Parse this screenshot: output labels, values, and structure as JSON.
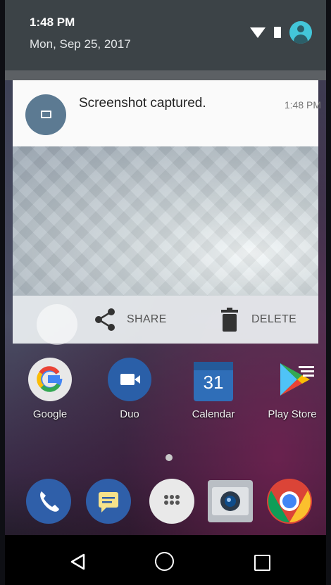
{
  "status": {
    "time": "1:48 PM",
    "date": "Mon, Sep 25, 2017"
  },
  "notification": {
    "title": "Screenshot captured.",
    "time": "1:48 PM",
    "icon": "image-icon"
  },
  "actions": {
    "share_label": "SHARE",
    "delete_label": "DELETE"
  },
  "apps": [
    {
      "label": "Google",
      "icon": "google-icon"
    },
    {
      "label": "Duo",
      "icon": "duo-icon"
    },
    {
      "label": "Calendar",
      "icon": "calendar-icon",
      "badge": "31"
    },
    {
      "label": "Play Store",
      "icon": "play-store-icon"
    }
  ],
  "dock": [
    {
      "icon": "phone-icon"
    },
    {
      "icon": "messages-icon"
    },
    {
      "icon": "app-drawer-icon"
    },
    {
      "icon": "camera-icon"
    },
    {
      "icon": "chrome-icon"
    }
  ],
  "colors": {
    "header": "#3c4347",
    "accent": "#43c6d9",
    "card": "#fafafa"
  }
}
